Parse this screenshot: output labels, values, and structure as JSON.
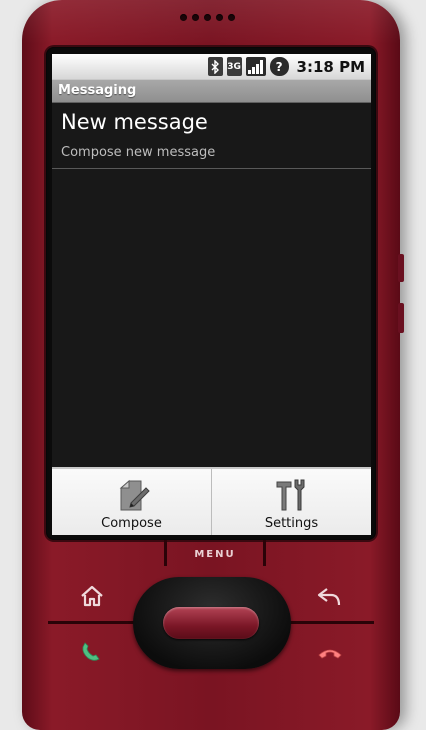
{
  "status_bar": {
    "time": "3:18 PM",
    "network_label": "3G",
    "icons": [
      "bluetooth-icon",
      "3g-icon",
      "signal-icon",
      "unknown-notification-icon"
    ]
  },
  "app": {
    "title": "Messaging"
  },
  "list": {
    "items": [
      {
        "title": "New message",
        "subtitle": "Compose new message"
      }
    ]
  },
  "menu": {
    "items": [
      {
        "label": "Compose",
        "icon": "compose-icon"
      },
      {
        "label": "Settings",
        "icon": "settings-tools-icon"
      }
    ]
  },
  "hardware": {
    "menu_key_label": "MENU",
    "keys": [
      "home-icon",
      "back-icon",
      "call-icon",
      "end-call-icon"
    ]
  },
  "colors": {
    "phone_body": "#7a1422",
    "screen_bg": "#181818",
    "title_bar": "#9a9a9a",
    "menu_panel": "#f2f2f2"
  }
}
